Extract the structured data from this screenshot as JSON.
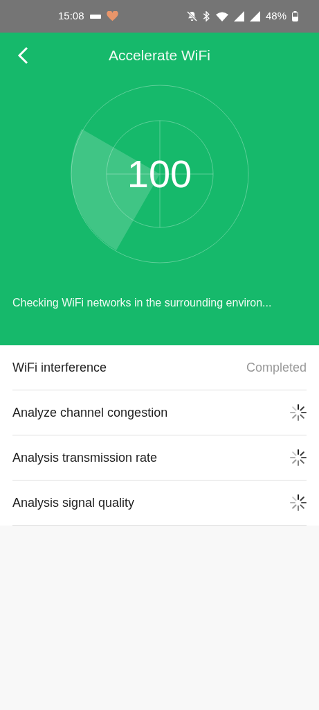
{
  "status_bar": {
    "time": "15:08",
    "battery": "48%"
  },
  "header": {
    "title": "Accelerate WiFi"
  },
  "scan": {
    "score": "100",
    "message": "Checking WiFi networks in the surrounding environ..."
  },
  "checks": [
    {
      "label": "WiFi interference",
      "kind": "done",
      "status": "Completed"
    },
    {
      "label": "Analyze channel congestion",
      "kind": "loading"
    },
    {
      "label": "Analysis transmission rate",
      "kind": "loading"
    },
    {
      "label": "Analysis signal quality",
      "kind": "loading"
    }
  ]
}
